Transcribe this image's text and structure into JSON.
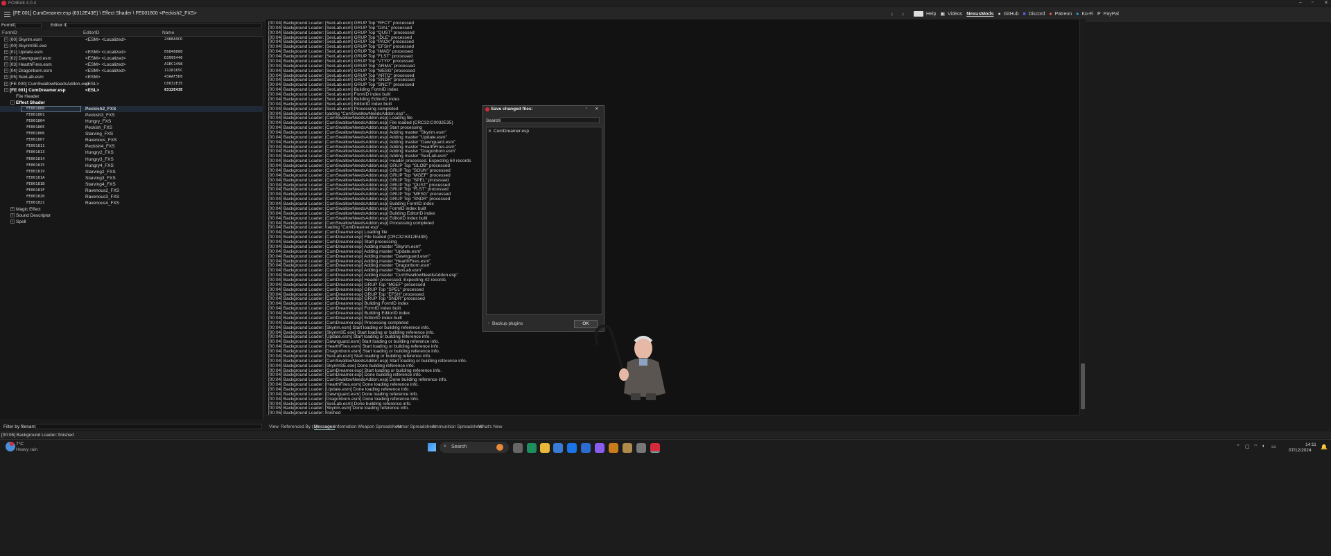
{
  "titlebar": {
    "app_title": "FO4Edit 4.0.4",
    "window_controls": [
      "–",
      "▫",
      "✕"
    ]
  },
  "menubar": {
    "path": "[FE 001] CumDreamer.esp (6312E43E) \\ Effect Shader \\ FE001800 <Peckish2_FXS>",
    "back": "‹",
    "forward": "›",
    "links": [
      "Help",
      "Videos",
      "NexusMods",
      "GitHub",
      "Discord",
      "Patreon",
      "Ko-Fi",
      "PayPal"
    ]
  },
  "filters": {
    "formid_label": "FormID",
    "editorid_label": "Editor ID",
    "filename_label": "Filter by filename:"
  },
  "tree": {
    "columns": [
      "FormID",
      "EditorID",
      "Name"
    ],
    "rows": [
      {
        "indent": 0,
        "exp": "+",
        "c1": "[00] Skyrim.esm",
        "c2": "<ESM> <Localized>",
        "c3": "2488A9CD"
      },
      {
        "indent": 0,
        "exp": "+",
        "c1": "[00] SkyrimSE.exe",
        "c2": "",
        "c3": ""
      },
      {
        "indent": 0,
        "exp": "+",
        "c1": "[01] Update.esm",
        "c2": "<ESM> <Localized>",
        "c3": "E6848888"
      },
      {
        "indent": 0,
        "exp": "+",
        "c1": "[02] Dawnguard.esm",
        "c2": "<ESM> <Localized>",
        "c3": "D3995446"
      },
      {
        "indent": 0,
        "exp": "+",
        "c1": "[03] HearthFires.esm",
        "c2": "<ESM> <Localized>",
        "c3": "A1EC1498"
      },
      {
        "indent": 0,
        "exp": "+",
        "c1": "[04] Dragonborn.esm",
        "c2": "<ESM> <Localized>",
        "c3": "1128165C"
      },
      {
        "indent": 0,
        "exp": "+",
        "c1": "[05] SexLab.esm",
        "c2": "<ESM>",
        "c3": "43AAF5D8"
      },
      {
        "indent": 0,
        "exp": "+",
        "c1": "[FE 000] CumSwallowNeedsAddon.esp",
        "c2": "<ESL>",
        "c3": "C0032E35"
      },
      {
        "indent": 0,
        "exp": "-",
        "c1": "[FE 001] CumDreamer.esp",
        "c2": "<ESL>",
        "c3": "6312E43E",
        "bold": true
      },
      {
        "indent": 1,
        "exp": "",
        "c1": "File Header",
        "c2": "",
        "c3": ""
      },
      {
        "indent": 1,
        "exp": "-",
        "c1": "Effect Shader",
        "c2": "",
        "c3": "",
        "bold": true
      },
      {
        "indent": 2,
        "exp": "",
        "c1": "FE001800",
        "c2": "Peckish2_FXS",
        "c3": "",
        "sel": true,
        "mono": true
      },
      {
        "indent": 2,
        "exp": "",
        "c1": "FE001801",
        "c2": "Peckish3_FXS",
        "c3": "",
        "mono": true
      },
      {
        "indent": 2,
        "exp": "",
        "c1": "FE001804",
        "c2": "Hungry_FXS",
        "c3": "",
        "mono": true
      },
      {
        "indent": 2,
        "exp": "",
        "c1": "FE001805",
        "c2": "Peckish_FXS",
        "c3": "",
        "mono": true
      },
      {
        "indent": 2,
        "exp": "",
        "c1": "FE001806",
        "c2": "Starving_FXS",
        "c3": "",
        "mono": true
      },
      {
        "indent": 2,
        "exp": "",
        "c1": "FE001807",
        "c2": "Ravenous_FXS",
        "c3": "",
        "mono": true
      },
      {
        "indent": 2,
        "exp": "",
        "c1": "FE001811",
        "c2": "Peckish4_FXS",
        "c3": "",
        "mono": true
      },
      {
        "indent": 2,
        "exp": "",
        "c1": "FE001813",
        "c2": "Hungry2_FXS",
        "c3": "",
        "mono": true
      },
      {
        "indent": 2,
        "exp": "",
        "c1": "FE001814",
        "c2": "Hungry3_FXS",
        "c3": "",
        "mono": true
      },
      {
        "indent": 2,
        "exp": "",
        "c1": "FE001815",
        "c2": "Hungry4_FXS",
        "c3": "",
        "mono": true
      },
      {
        "indent": 2,
        "exp": "",
        "c1": "FE001819",
        "c2": "Starving2_FXS",
        "c3": "",
        "mono": true
      },
      {
        "indent": 2,
        "exp": "",
        "c1": "FE00181A",
        "c2": "Starving3_FXS",
        "c3": "",
        "mono": true
      },
      {
        "indent": 2,
        "exp": "",
        "c1": "FE00181B",
        "c2": "Starving4_FXS",
        "c3": "",
        "mono": true
      },
      {
        "indent": 2,
        "exp": "",
        "c1": "FE00181F",
        "c2": "Ravenous2_FXS",
        "c3": "",
        "mono": true
      },
      {
        "indent": 2,
        "exp": "",
        "c1": "FE001820",
        "c2": "Ravenous3_FXS",
        "c3": "",
        "mono": true
      },
      {
        "indent": 2,
        "exp": "",
        "c1": "FE001821",
        "c2": "Ravenous4_FXS",
        "c3": "",
        "mono": true
      },
      {
        "indent": 1,
        "exp": "+",
        "c1": "Magic Effect",
        "c2": "",
        "c3": ""
      },
      {
        "indent": 1,
        "exp": "+",
        "c1": "Sound Descriptor",
        "c2": "",
        "c3": ""
      },
      {
        "indent": 1,
        "exp": "+",
        "c1": "Spell",
        "c2": "",
        "c3": ""
      }
    ]
  },
  "log": [
    "[00:04] Background Loader: [SexLab.esm] GRUP Top \"RFCT\" processed",
    "[00:04] Background Loader: [SexLab.esm] GRUP Top \"DIAL\" processed",
    "[00:04] Background Loader: [SexLab.esm] GRUP Top \"QUST\" processed",
    "[00:04] Background Loader: [SexLab.esm] GRUP Top \"IDLE\" processed",
    "[00:04] Background Loader: [SexLab.esm] GRUP Top \"PACK\" processed",
    "[00:04] Background Loader: [SexLab.esm] GRUP Top \"EFSH\" processed",
    "[00:04] Background Loader: [SexLab.esm] GRUP Top \"IMAD\" processed",
    "[00:04] Background Loader: [SexLab.esm] GRUP Top \"FLST\" processed",
    "[00:04] Background Loader: [SexLab.esm] GRUP Top \"VTYP\" processed",
    "[00:04] Background Loader: [SexLab.esm] GRUP Top \"ARMA\" processed",
    "[00:04] Background Loader: [SexLab.esm] GRUP Top \"MESG\" processed",
    "[00:04] Background Loader: [SexLab.esm] GRUP Top \"ARTO\" processed",
    "[00:04] Background Loader: [SexLab.esm] GRUP Top \"SNDR\" processed",
    "[00:04] Background Loader: [SexLab.esm] GRUP Top \"SNCT\" processed",
    "[00:04] Background Loader: [SexLab.esm] Building FormID index",
    "[00:04] Background Loader: [SexLab.esm] FormID index built",
    "[00:04] Background Loader: [SexLab.esm] Building EditorID index",
    "[00:04] Background Loader: [SexLab.esm] EditorID index built",
    "[00:04] Background Loader: [SexLab.esm] Processing completed",
    "[00:04] Background Loader: loading \"CumSwallowNeedsAddon.esp\"...",
    "[00:04] Background Loader: [CumSwallowNeedsAddon.esp] Loading file",
    "[00:04] Background Loader: [CumSwallowNeedsAddon.esp] File loaded (CRC32:C0032E35)",
    "[00:04] Background Loader: [CumSwallowNeedsAddon.esp] Start processing",
    "[00:04] Background Loader: [CumSwallowNeedsAddon.esp] Adding master \"Skyrim.esm\"",
    "[00:04] Background Loader: [CumSwallowNeedsAddon.esp] Adding master \"Update.esm\"",
    "[00:04] Background Loader: [CumSwallowNeedsAddon.esp] Adding master \"Dawnguard.esm\"",
    "[00:04] Background Loader: [CumSwallowNeedsAddon.esp] Adding master \"HearthFires.esm\"",
    "[00:04] Background Loader: [CumSwallowNeedsAddon.esp] Adding master \"Dragonborn.esm\"",
    "[00:04] Background Loader: [CumSwallowNeedsAddon.esp] Adding master \"SexLab.esm\"",
    "[00:04] Background Loader: [CumSwallowNeedsAddon.esp] Header processed. Expecting 64 records",
    "[00:04] Background Loader: [CumSwallowNeedsAddon.esp] GRUP Top \"GLOB\" processed",
    "[00:04] Background Loader: [CumSwallowNeedsAddon.esp] GRUP Top \"SOUN\" processed",
    "[00:04] Background Loader: [CumSwallowNeedsAddon.esp] GRUP Top \"MGEF\" processed",
    "[00:04] Background Loader: [CumSwallowNeedsAddon.esp] GRUP Top \"SPEL\" processed",
    "[00:04] Background Loader: [CumSwallowNeedsAddon.esp] GRUP Top \"QUST\" processed",
    "[00:04] Background Loader: [CumSwallowNeedsAddon.esp] GRUP Top \"FLST\" processed",
    "[00:04] Background Loader: [CumSwallowNeedsAddon.esp] GRUP Top \"MESG\" processed",
    "[00:04] Background Loader: [CumSwallowNeedsAddon.esp] GRUP Top \"SNDR\" processed",
    "[00:04] Background Loader: [CumSwallowNeedsAddon.esp] Building FormID index",
    "[00:04] Background Loader: [CumSwallowNeedsAddon.esp] FormID index built",
    "[00:04] Background Loader: [CumSwallowNeedsAddon.esp] Building EditorID index",
    "[00:04] Background Loader: [CumSwallowNeedsAddon.esp] EditorID index built",
    "[00:04] Background Loader: [CumSwallowNeedsAddon.esp] Processing completed",
    "[00:04] Background Loader: loading \"CumDreamer.esp\"...",
    "[00:04] Background Loader: [CumDreamer.esp] Loading file",
    "[00:04] Background Loader: [CumDreamer.esp] File loaded (CRC32:6312E43E)",
    "[00:04] Background Loader: [CumDreamer.esp] Start processing",
    "[00:04] Background Loader: [CumDreamer.esp] Adding master \"Skyrim.esm\"",
    "[00:04] Background Loader: [CumDreamer.esp] Adding master \"Update.esm\"",
    "[00:04] Background Loader: [CumDreamer.esp] Adding master \"Dawnguard.esm\"",
    "[00:04] Background Loader: [CumDreamer.esp] Adding master \"HearthFires.esm\"",
    "[00:04] Background Loader: [CumDreamer.esp] Adding master \"Dragonborn.esm\"",
    "[00:04] Background Loader: [CumDreamer.esp] Adding master \"SexLab.esm\"",
    "[00:04] Background Loader: [CumDreamer.esp] Adding master \"CumSwallowNeedsAddon.esp\"",
    "[00:04] Background Loader: [CumDreamer.esp] Header processed. Expecting 42 records",
    "[00:04] Background Loader: [CumDreamer.esp] GRUP Top \"MGEF\" processed",
    "[00:04] Background Loader: [CumDreamer.esp] GRUP Top \"SPEL\" processed",
    "[00:04] Background Loader: [CumDreamer.esp] GRUP Top \"EFSH\" processed",
    "[00:04] Background Loader: [CumDreamer.esp] GRUP Top \"SNDR\" processed",
    "[00:04] Background Loader: [CumDreamer.esp] Building FormID index",
    "[00:04] Background Loader: [CumDreamer.esp] FormID index built",
    "[00:04] Background Loader: [CumDreamer.esp] Building EditorID index",
    "[00:04] Background Loader: [CumDreamer.esp] EditorID index built",
    "[00:04] Background Loader: [CumDreamer.esp] Processing completed",
    "[00:04] Background Loader: [Skyrim.esm] Start loading or building reference info.",
    "[00:04] Background Loader: [SkyrimSE.exe] Start loading or building reference info.",
    "[00:04] Background Loader: [Update.esm] Start loading or building reference info.",
    "[00:04] Background Loader: [Dawnguard.esm] Start loading or building reference info.",
    "[00:04] Background Loader: [HearthFires.esm] Start loading or building reference info.",
    "[00:04] Background Loader: [Dragonborn.esm] Start loading or building reference info.",
    "[00:04] Background Loader: [SexLab.esm] Start loading or building reference info.",
    "[00:04] Background Loader: [CumSwallowNeedsAddon.esp] Start loading or building reference info.",
    "[00:04] Background Loader: [SkyrimSE.exe] Done building reference info.",
    "[00:04] Background Loader: [CumDreamer.esp] Start loading or building reference info.",
    "[00:04] Background Loader: [CumDreamer.esp] Done building reference info.",
    "[00:04] Background Loader: [CumSwallowNeedsAddon.esp] Done building reference info.",
    "[00:04] Background Loader: [HearthFires.esm] Done loading reference info.",
    "[00:04] Background Loader: [Update.esm] Done loading reference info.",
    "[00:04] Background Loader: [Dawnguard.esm] Done loading reference info.",
    "[00:04] Background Loader: [Dragonborn.esm] Done loading reference info.",
    "[00:04] Background Loader: [SexLab.esm] Done building reference info.",
    "[00:05] Background Loader: [Skyrim.esm] Done loading reference info.",
    "[00:06] Background Loader: finished"
  ],
  "tabs": [
    "View",
    "Referenced By (1)",
    "Messages",
    "Information",
    "Weapon Spreadsheet",
    "Armor Spreadsheet",
    "Ammunition Spreadsheet",
    "What's New"
  ],
  "status": "[00:06] Background Loader: finished",
  "dialog": {
    "title": "Save changed files:",
    "search_label": "Search",
    "file": "CumDreamer.esp",
    "backup": "Backup plugins",
    "ok": "OK"
  },
  "taskbar": {
    "weather_temp": "7°C",
    "weather_desc": "Heavy rain",
    "search": "Search",
    "time": "14:11",
    "date": "07/12/2024"
  },
  "colors": {
    "accent": "#d42a3a",
    "selection": "#202a36"
  }
}
